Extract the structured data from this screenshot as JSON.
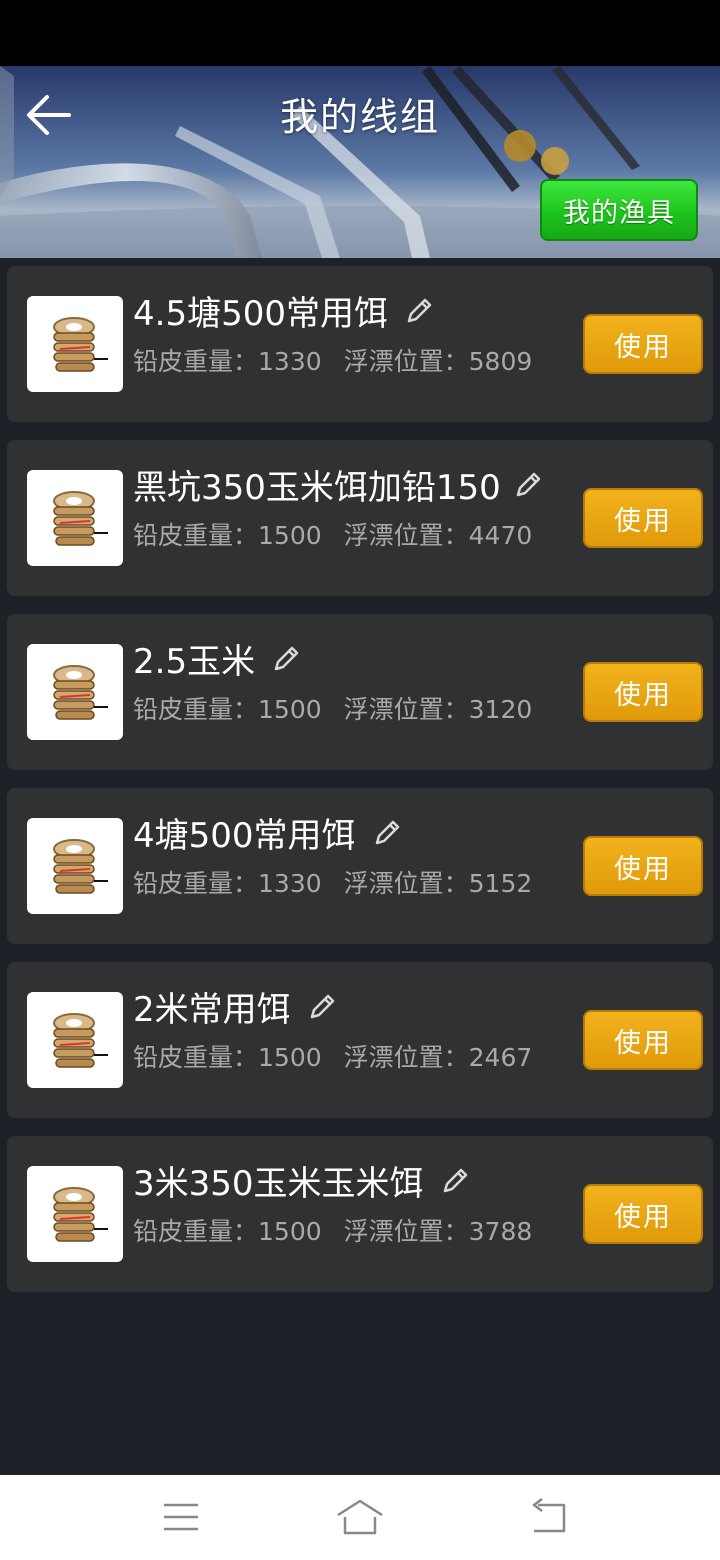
{
  "header": {
    "title": "我的线组",
    "gear_button_label": "我的渔具",
    "back_icon": "arrow-left-icon"
  },
  "labels": {
    "sinker_weight": "铅皮重量：",
    "float_position": "浮漂位置："
  },
  "lines": [
    {
      "name": "4.5塘500常用饵",
      "sinker_weight": "1330",
      "float_position": "5809",
      "button": "使用"
    },
    {
      "name": "黑坑350玉米饵加铅150",
      "sinker_weight": "1500",
      "float_position": "4470",
      "button": "使用"
    },
    {
      "name": "2.5玉米",
      "sinker_weight": "1500",
      "float_position": "3120",
      "button": "使用"
    },
    {
      "name": "4塘500常用饵",
      "sinker_weight": "1330",
      "float_position": "5152",
      "button": "使用"
    },
    {
      "name": "2米常用饵",
      "sinker_weight": "1500",
      "float_position": "2467",
      "button": "使用"
    },
    {
      "name": "3米350玉米玉米饵",
      "sinker_weight": "1500",
      "float_position": "3788",
      "button": "使用"
    }
  ],
  "nav": {
    "icons": [
      "menu-icon",
      "home-icon",
      "back-icon"
    ]
  },
  "colors": {
    "use_button": "#e5a010",
    "gear_button": "#22cc22",
    "card_bg": "#303133",
    "page_bg": "#1e2228"
  }
}
